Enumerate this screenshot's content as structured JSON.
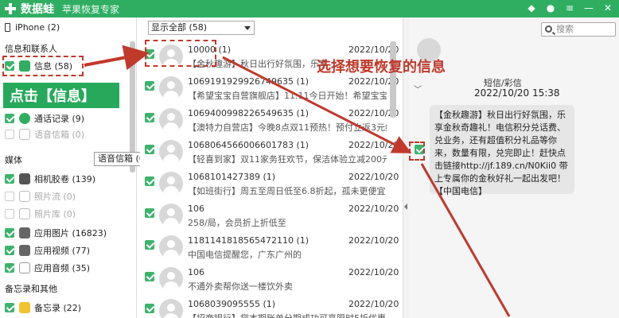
{
  "app": {
    "name": "数据蛙",
    "subtitle": "苹果恢复专家"
  },
  "sidebar": {
    "device": "iPhone (2)",
    "section_messages": "信息和联系人",
    "items": [
      {
        "label": "信息 (58)",
        "checked": true
      },
      {
        "label": "通话记录 (9)",
        "checked": true
      },
      {
        "label": "语音信箱 (0)",
        "checked": false,
        "dim": true
      }
    ],
    "tooltip": "语音信箱 (0)",
    "section_media": "媒体",
    "media_items": [
      {
        "label": "相机胶卷 (139)",
        "checked": true
      },
      {
        "label": "照片流 (0)",
        "checked": false,
        "dim": true
      },
      {
        "label": "照片库 (0)",
        "checked": false,
        "dim": true
      },
      {
        "label": "应用图片 (16823)",
        "checked": true
      },
      {
        "label": "应用视频 (77)",
        "checked": true
      },
      {
        "label": "应用音频 (35)",
        "checked": true
      }
    ],
    "section_memo": "备忘录和其他",
    "memo_items": [
      {
        "label": "备忘录 (22)",
        "checked": true
      }
    ]
  },
  "annotations": {
    "click_hint": "点击【信息】",
    "select_hint": "选择想要恢复的信息"
  },
  "list": {
    "filter": "显示全部 (58)",
    "items": [
      {
        "sender": "10000 (1)",
        "date": "2022/10/20",
        "preview": "【金秋趣游】秋日出行好氛围，乐享"
      },
      {
        "sender": "1069191929926749635 (1)",
        "date": "2022/10/20",
        "preview": "【希望宝宝自营旗舰店】11.11今日开始！希望宝宝中国"
      },
      {
        "sender": "1069400998226549635 (1)",
        "date": "2022/10/20",
        "preview": "【澳特力自营店】今晚8点双11预热！预付立返3元红卡"
      },
      {
        "sender": "1068064566006601783 (1)",
        "date": "2022/10/20",
        "preview": "【轻喜到家】双11家务狂欢节，保洁体验立减200元"
      },
      {
        "sender": "1068101427389 (1)",
        "date": "2022/10/20",
        "preview": "【如班街行】周五至周日低至6.8折起，孤未更便宜，"
      },
      {
        "sender": "106",
        "date": "2022/10/20",
        "preview": "258/局，会员折上折低至"
      },
      {
        "sender": "1181141818565472110 (1)",
        "date": "2022/10/20",
        "preview": "中国电信提醒您，广东广州的"
      },
      {
        "sender": "106",
        "date": "2022/10/20",
        "preview": "不通外卖帮你送一楼饮外卖"
      },
      {
        "sender": "1068039095555 (1)",
        "date": "2022/10/20",
        "preview": "【招商银行】您本期账单分期成功可享限时5折优惠"
      }
    ]
  },
  "detail": {
    "search_placeholder": "搜索",
    "msg_type": "短信/彩信",
    "msg_time": "2022/10/20 15:38",
    "msg_body": "【金秋趣游】秋日出行好氛围，乐享金秋奇趣礼！电信积分兑话费、兑业务，还有超值积分礼品等你来，数量有限，兑完即止！赶快点击链接http://jf.189.cn/N0Kii0 带上专属你的金秋好礼一起出发吧！【中国电信】"
  },
  "colors": {
    "titlebar": "#2fae62",
    "check": "#3cb46b",
    "annotation": "#c0392b"
  }
}
